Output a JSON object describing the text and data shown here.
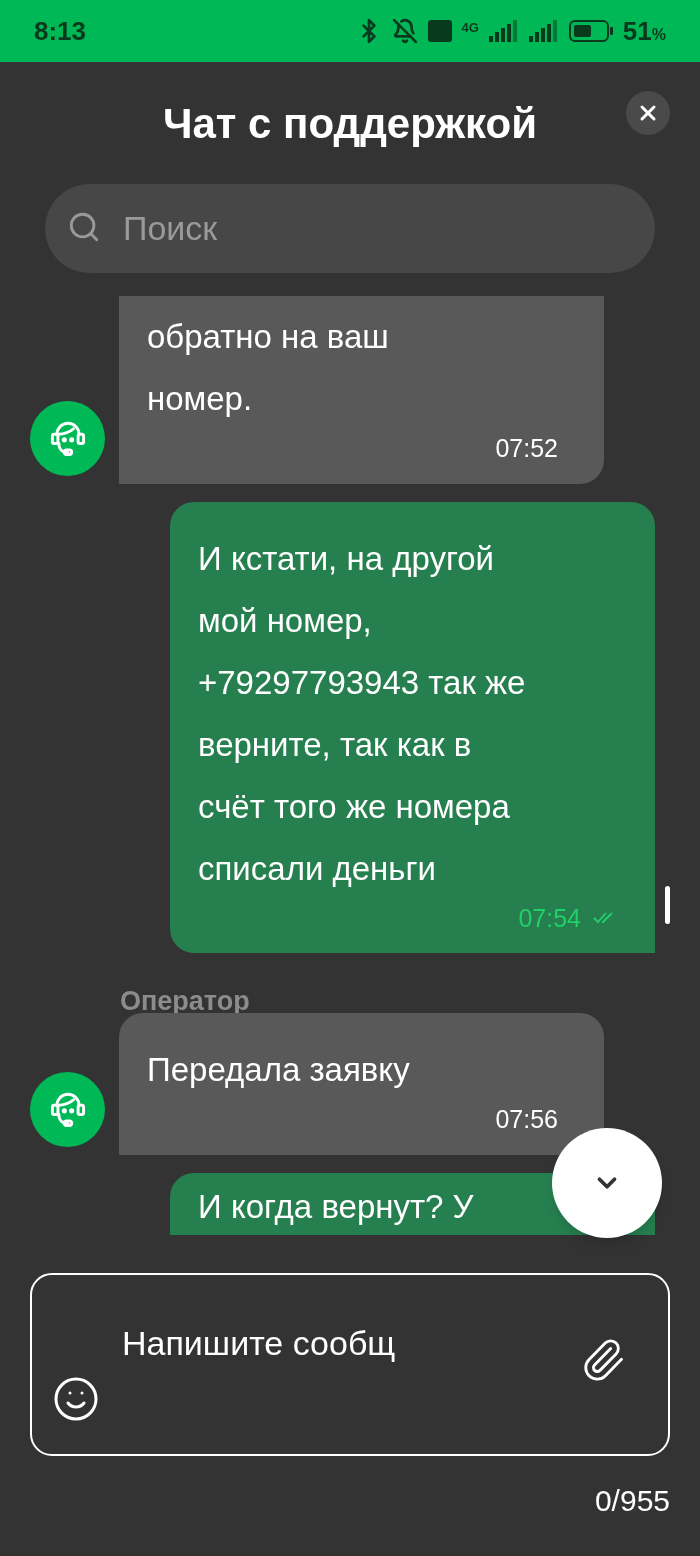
{
  "status_bar": {
    "time": "8:13",
    "network": "4G",
    "battery": "51",
    "battery_unit": "%"
  },
  "header": {
    "title": "Чат с поддержкой"
  },
  "search": {
    "placeholder": "Поиск"
  },
  "messages": [
    {
      "kind": "incoming",
      "cut_top": true,
      "cut_bottom": false,
      "lines": [
        "обратно на ваш",
        "номер."
      ],
      "time": "07:52"
    },
    {
      "kind": "outgoing",
      "cut_top": false,
      "cut_bottom": false,
      "lines": [
        "И кстати, на другой",
        "мой номер,",
        "+79297793943 так же",
        "верните, так как в",
        "счёт того же номера",
        "списали деньги"
      ],
      "time": "07:54",
      "read": true
    },
    {
      "kind": "incoming",
      "cut_top": false,
      "cut_bottom": false,
      "sender": "Оператор",
      "lines": [
        "Передала заявку"
      ],
      "time": "07:56"
    },
    {
      "kind": "outgoing",
      "cut_top": false,
      "cut_bottom": true,
      "lines": [
        "И когда вернут? У"
      ]
    }
  ],
  "composer": {
    "placeholder": "Напишите сообщ",
    "counter": "0/955"
  }
}
